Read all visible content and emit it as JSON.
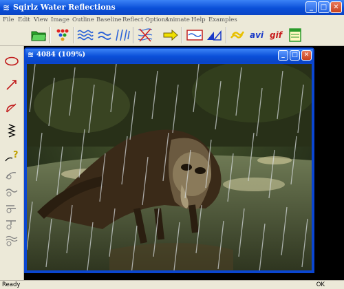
{
  "window": {
    "title": "Sqirlz Water Reflections",
    "icon": "ripple-app-icon"
  },
  "menu": [
    {
      "label": "File"
    },
    {
      "label": "Edit"
    },
    {
      "label": "View"
    },
    {
      "label": "Image"
    },
    {
      "label": "Outline"
    },
    {
      "label": "Baseline"
    },
    {
      "label": "Reflect Options"
    },
    {
      "label": "Animate"
    },
    {
      "label": "Help"
    },
    {
      "label": "Examples"
    }
  ],
  "toolbar": {
    "avi_label": "avi",
    "gif_label": "gif"
  },
  "child_window": {
    "title": "4084  (109%)"
  },
  "status": {
    "left": "Ready",
    "right": "OK"
  },
  "colors": {
    "title_blue": "#0a4fd8",
    "close_red": "#c8421f",
    "menu_bg": "#ece9d8"
  }
}
